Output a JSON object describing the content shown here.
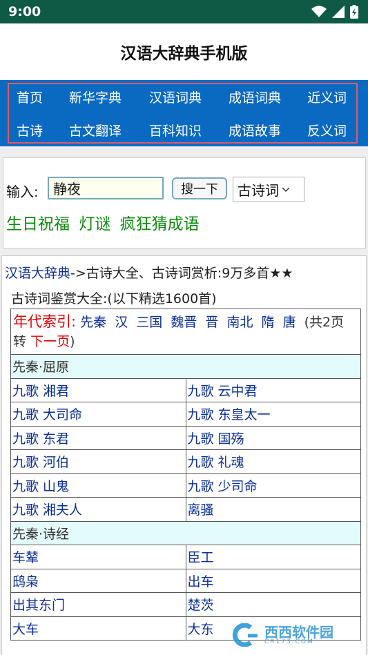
{
  "status_bar": {
    "time": "9:00"
  },
  "header": {
    "title": "汉语大辞典手机版"
  },
  "nav": {
    "row1": [
      "首页",
      "新华字典",
      "汉语词典",
      "成语词典",
      "近义词"
    ],
    "row2": [
      "古诗",
      "古文翻译",
      "百科知识",
      "成语故事",
      "反义词"
    ]
  },
  "search": {
    "label": "输入:",
    "value": "静夜",
    "button": "搜一下",
    "select_value": "古诗词",
    "quick_links": [
      "生日祝福",
      "灯谜",
      "疯狂猜成语"
    ]
  },
  "breadcrumb": {
    "link": "汉语大辞典",
    "text": "->古诗大全、古诗词赏析:9万多首★★"
  },
  "subtitle": "古诗词鉴赏大全:(以下精选1600首)",
  "index": {
    "label": "年代索引:",
    "eras": [
      "先秦",
      "汉",
      "三国",
      "魏晋",
      "晋",
      "南北",
      "隋",
      "唐"
    ],
    "pages_text": "(共2页 转",
    "next_link": "下一页",
    "close": ")"
  },
  "sections": [
    {
      "title": "先秦·屈原",
      "rows": [
        [
          "九歌 湘君",
          "九歌 云中君"
        ],
        [
          "九歌 大司命",
          "九歌 东皇太一"
        ],
        [
          "九歌 东君",
          "九歌 国殇"
        ],
        [
          "九歌 河伯",
          "九歌 礼魂"
        ],
        [
          "九歌 山鬼",
          "九歌 少司命"
        ],
        [
          "九歌 湘夫人",
          "离骚"
        ]
      ]
    },
    {
      "title": "先秦·诗经",
      "rows": [
        [
          "车辇",
          "臣工"
        ],
        [
          "鸱枭",
          "出车"
        ],
        [
          "出其东门",
          "楚茨"
        ],
        [
          "大车",
          "大东"
        ]
      ]
    }
  ],
  "watermark": {
    "logo_text": "西西",
    "site": "软件园",
    "domain": "CR173.COM"
  },
  "colors": {
    "status_bar": "#0e5a45",
    "nav_bg": "#0a6ac2",
    "nav_border": "#e05a6a",
    "link": "#0a2e9a",
    "green_link": "#0a8a0a",
    "red": "#e00000",
    "section_bg": "#e4fbfb"
  }
}
